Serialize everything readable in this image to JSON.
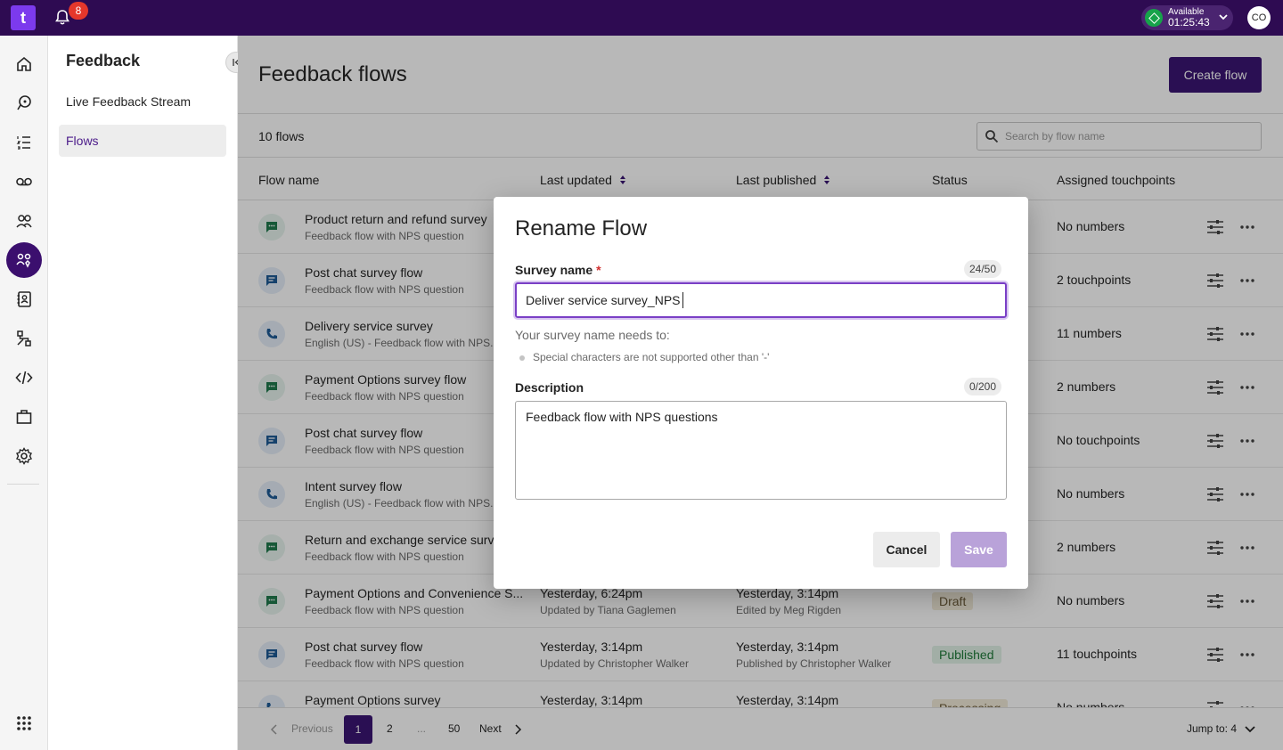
{
  "topbar": {
    "logo_text": "t",
    "notifications_count": "8",
    "status_label": "Available",
    "status_time": "01:25:43",
    "avatar_initials": "CO"
  },
  "rail": {
    "items": [
      "home-icon",
      "inbox-icon",
      "list-numbered-icon",
      "voicemail-icon",
      "people-icon",
      "feedback-icon",
      "contacts-icon",
      "flow-icon",
      "code-icon",
      "briefcase-icon",
      "gear-icon",
      "apps-grid-icon"
    ],
    "active": "feedback-icon"
  },
  "subnav": {
    "title": "Feedback",
    "items": [
      {
        "label": "Live Feedback Stream"
      },
      {
        "label": "Flows"
      }
    ]
  },
  "main": {
    "title": "Feedback flows",
    "create_button": "Create flow",
    "flows_count": "10 flows",
    "search_placeholder": "Search by flow name",
    "columns": [
      "Flow name",
      "Last updated",
      "Last published",
      "Status",
      "Assigned touchpoints"
    ],
    "rows": [
      {
        "icon": "chat-icon",
        "title": "Product return and refund survey",
        "sub": "Feedback flow with NPS question",
        "updated": "",
        "updated_by": "",
        "published": "",
        "published_by": "",
        "status": "",
        "touchpoints": "No numbers"
      },
      {
        "icon": "chat-bubble-icon",
        "title": "Post chat survey flow",
        "sub": "Feedback flow with NPS question",
        "updated": "",
        "updated_by": "",
        "published": "",
        "published_by": "",
        "status": "",
        "touchpoints": "2 touchpoints"
      },
      {
        "icon": "phone-icon",
        "title": "Delivery service survey",
        "sub": "English (US) - Feedback flow with NPS...",
        "updated": "",
        "updated_by": "",
        "published": "",
        "published_by": "",
        "status": "",
        "touchpoints": "11 numbers"
      },
      {
        "icon": "chat-icon",
        "title": "Payment Options survey flow",
        "sub": "Feedback flow with NPS question",
        "updated": "",
        "updated_by": "",
        "published": "",
        "published_by": "",
        "status": "",
        "touchpoints": "2 numbers"
      },
      {
        "icon": "chat-bubble-icon",
        "title": "Post chat survey flow",
        "sub": "Feedback flow with NPS question",
        "updated": "",
        "updated_by": "",
        "published": "",
        "published_by": "",
        "status": "",
        "touchpoints": "No touchpoints"
      },
      {
        "icon": "phone-icon",
        "title": "Intent survey flow",
        "sub": "English (US) - Feedback flow with NPS...",
        "updated": "",
        "updated_by": "",
        "published": "",
        "published_by": "",
        "status": "",
        "touchpoints": "No numbers"
      },
      {
        "icon": "chat-icon",
        "title": "Return and exchange service surv",
        "sub": "Feedback flow with NPS question",
        "updated": "",
        "updated_by": "",
        "published": "",
        "published_by": "",
        "status": "",
        "touchpoints": "2 numbers"
      },
      {
        "icon": "chat-icon",
        "title": "Payment Options and Convenience S...",
        "sub": "Feedback flow with NPS question",
        "updated": "Yesterday, 6:24pm",
        "updated_by": "Updated by Tiana Gaglemen",
        "published": "Yesterday, 3:14pm",
        "published_by": "Edited by Meg Rigden",
        "status": "Draft",
        "touchpoints": "No numbers"
      },
      {
        "icon": "chat-bubble-icon",
        "title": "Post chat survey flow",
        "sub": "Feedback flow with NPS question",
        "updated": "Yesterday, 3:14pm",
        "updated_by": "Updated by Christopher Walker",
        "published": "Yesterday, 3:14pm",
        "published_by": "Published by Christopher Walker",
        "status": "Published",
        "touchpoints": "11 touchpoints"
      },
      {
        "icon": "phone-icon",
        "title": "Payment Options survey",
        "sub": "",
        "updated": "Yesterday, 3:14pm",
        "updated_by": "",
        "published": "Yesterday, 3:14pm",
        "published_by": "",
        "status": "Processing",
        "touchpoints": "No numbers"
      }
    ],
    "pagination": {
      "previous": "Previous",
      "pages": [
        "1",
        "2",
        "...",
        "50"
      ],
      "next": "Next",
      "jump_to": "Jump to: 4"
    }
  },
  "modal": {
    "title": "Rename Flow",
    "name_label": "Survey name",
    "required_mark": "*",
    "name_counter": "24/50",
    "name_value": "Deliver service survey_NPS",
    "hint_title": "Your survey name needs to:",
    "hint_item": "Special characters are not supported other than '-'",
    "desc_label": "Description",
    "desc_counter": "0/200",
    "desc_value": "Feedback flow with NPS questions",
    "cancel": "Cancel",
    "save": "Save"
  },
  "colors": {
    "topbar": "#2e0b52",
    "accent": "#3b1673",
    "focus": "#7a3fc6",
    "available": "#16a34a",
    "badge": "#e5372b"
  }
}
